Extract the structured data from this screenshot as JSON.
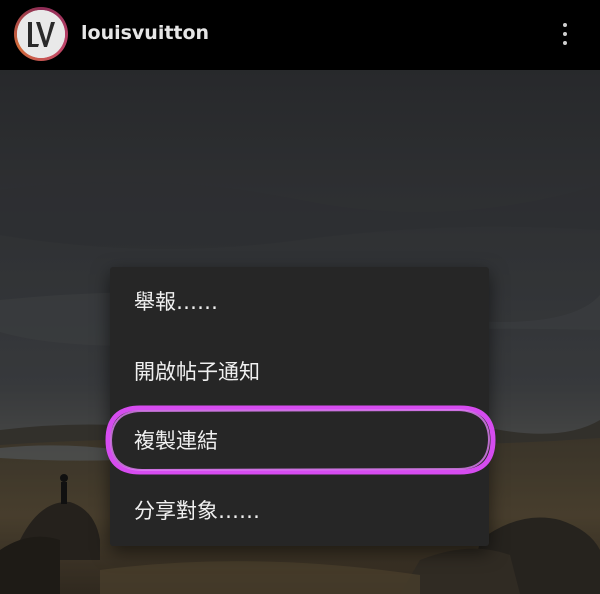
{
  "header": {
    "username": "louisvuitton",
    "avatar_label": "LV",
    "more_icon": "more-vertical-icon"
  },
  "menu": {
    "items": [
      {
        "label": "舉報……"
      },
      {
        "label": "開啟帖子通知"
      },
      {
        "label": "複製連結"
      },
      {
        "label": "分享對象……"
      }
    ]
  },
  "colors": {
    "header_bg": "#000000",
    "menu_bg": "#262626",
    "menu_text": "#f0f0f0",
    "highlight": "#d64cf0"
  }
}
